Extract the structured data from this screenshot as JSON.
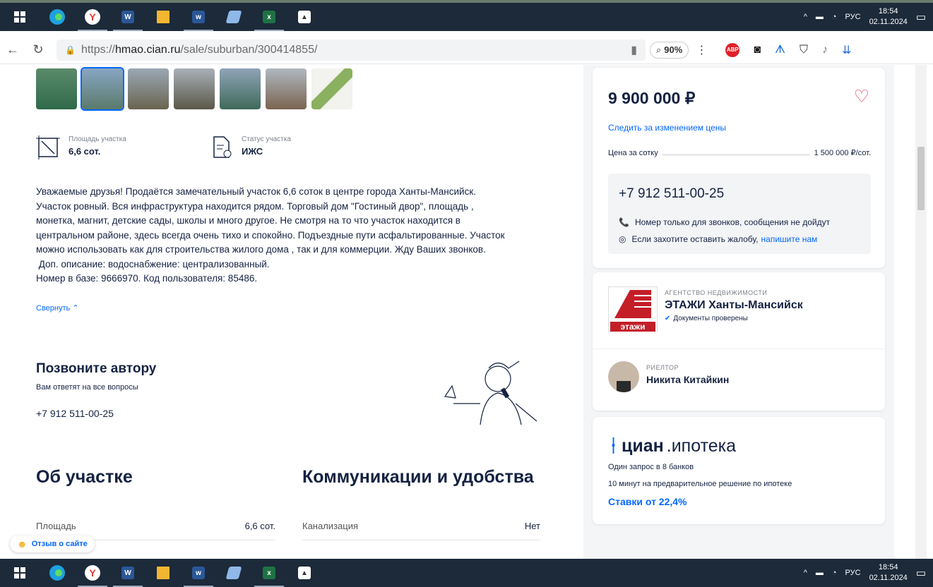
{
  "taskbar": {
    "lang": "РУС",
    "time": "18:54",
    "date": "02.11.2024",
    "apps": [
      "start-icon",
      "edge-icon",
      "yandex-browser-icon",
      "word-icon",
      "file-explorer-icon",
      "word-doc-icon",
      "notes-icon",
      "excel-icon",
      "photos-icon"
    ]
  },
  "browser": {
    "url_prefix": "https://",
    "url_host": "hmao.cian.ru",
    "url_path": "/sale/suburban/300414855/",
    "zoom": "90%"
  },
  "listing": {
    "features": [
      {
        "label": "Площадь участка",
        "value": "6,6 сот."
      },
      {
        "label": "Статус участка",
        "value": "ИЖС"
      }
    ],
    "description": [
      "Уважаемые друзья! Продаётся замечательный участок 6,6 соток в центре города Ханты-Мансийск.",
      "Участок ровный. Вся инфраструктура находится рядом. Торговый дом \"Гостиный двор\", площадь ,",
      "монетка, магнит, детские сады, школы и много другое. Не смотря на то что участок находится в",
      "центральном районе, здесь всегда очень тихо и спокойно. Подъездные пути асфальтированные. Участок",
      "можно использовать как для строительства жилого дома , так и для коммерции. Жду Ваших звонков.",
      " Доп. описание: водоснабжение: централизованный.",
      "Номер в базе: 9666970. Код пользователя: 85486."
    ],
    "collapse": "Свернуть"
  },
  "call": {
    "title": "Позвоните автору",
    "subtitle": "Вам ответят на все вопросы",
    "phone": "+7 912 511-00-25"
  },
  "sections": {
    "about": "Об участке",
    "comm": "Коммуникации и удобства",
    "about_row": {
      "label": "Площадь",
      "value": "6,6 сот."
    },
    "comm_row": {
      "label": "Канализация",
      "value": "Нет"
    }
  },
  "price_card": {
    "price": "9 900 000 ₽",
    "watch": "Следить за изменением цены",
    "per_label": "Цена за сотку",
    "per_value": "1 500 000 ₽/сот.",
    "phone": "+7 912 511-00-25",
    "note1": "Номер только для звонков, сообщения не дойдут",
    "note2_prefix": "Если захотите оставить жалобу,",
    "note2_link": "напишите нам"
  },
  "agency": {
    "label": "АГЕНТСТВО НЕДВИЖИМОСТИ",
    "name": "ЭТАЖИ Ханты-Мансийск",
    "verified": "Документы проверены",
    "logo_text": "этажи",
    "realtor_label": "РИЕЛТОР",
    "realtor_name": "Никита Китайкин"
  },
  "ipoteka": {
    "brand_bold": "циан",
    "brand_rest": ".ипотека",
    "line1": "Один запрос в 8 банков",
    "line2": "10 минут на предварительное решение по ипотеке",
    "rates": "Ставки от 22,4%"
  },
  "feedback": "Отзыв о сайте",
  "colors": {
    "accent": "#0468ff",
    "heart": "#e84260",
    "agency_red": "#c41e28"
  }
}
